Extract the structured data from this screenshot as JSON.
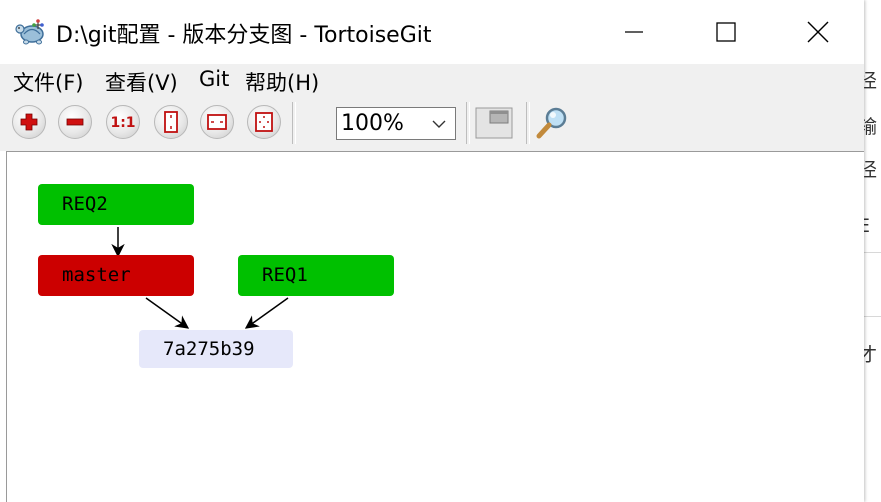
{
  "window": {
    "title": "D:\\git配置 - 版本分支图 - TortoiseGit",
    "app_icon": "tortoisegit-icon",
    "controls": [
      "minimize-icon",
      "maximize-icon",
      "close-icon"
    ]
  },
  "menu": {
    "items": [
      {
        "label": "文件(F)"
      },
      {
        "label": "查看(V)"
      },
      {
        "label": "Git"
      },
      {
        "label": "帮助(H)"
      }
    ]
  },
  "toolbar": {
    "buttons": [
      {
        "icon": "zoom-in-icon",
        "glyph": "plus"
      },
      {
        "icon": "zoom-out-icon",
        "glyph": "minus"
      },
      {
        "icon": "actual-size-icon",
        "glyph": "1:1"
      },
      {
        "icon": "fit-height-icon"
      },
      {
        "icon": "fit-width-icon"
      },
      {
        "icon": "fit-window-icon"
      }
    ],
    "zoom_value": "100%",
    "overview_icon": "overview-window-icon",
    "search_icon": "magnifier-icon"
  },
  "graph": {
    "nodes": [
      {
        "id": "req2",
        "label": "REQ2",
        "kind": "branch",
        "color": "#00c000"
      },
      {
        "id": "master",
        "label": "master",
        "kind": "current-branch",
        "color": "#cc0000"
      },
      {
        "id": "req1",
        "label": "REQ1",
        "kind": "branch",
        "color": "#00c000"
      },
      {
        "id": "commit",
        "label": "7a275b39",
        "kind": "commit",
        "color": "#e6e8fa"
      }
    ],
    "edges": [
      {
        "from": "req2",
        "to": "master"
      },
      {
        "from": "master",
        "to": "commit"
      },
      {
        "from": "req1",
        "to": "commit"
      }
    ]
  },
  "background_window_glyphs": [
    "径",
    "输",
    "径",
    "E",
    "才"
  ]
}
